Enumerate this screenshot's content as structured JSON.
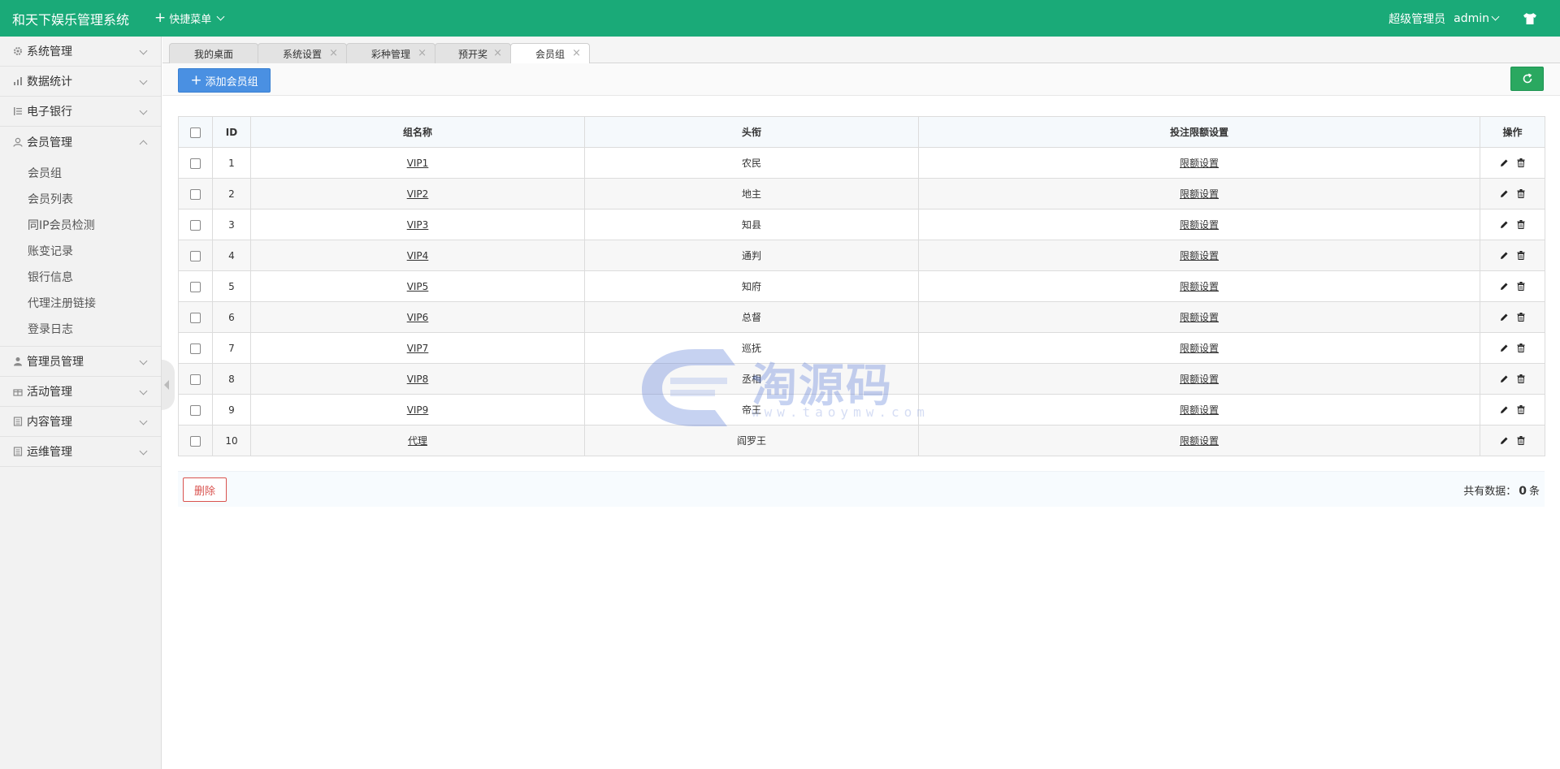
{
  "header": {
    "brand": "和天下娱乐管理系统",
    "quick_menu": "快捷菜单",
    "role": "超级管理员",
    "user": "admin"
  },
  "sidebar": {
    "items": [
      {
        "label": "系统管理",
        "icon": "gear-icon"
      },
      {
        "label": "数据统计",
        "icon": "chart-icon"
      },
      {
        "label": "电子银行",
        "icon": "list-icon"
      },
      {
        "label": "会员管理",
        "icon": "user-icon"
      },
      {
        "label": "管理员管理",
        "icon": "admin-icon"
      },
      {
        "label": "活动管理",
        "icon": "gift-icon"
      },
      {
        "label": "内容管理",
        "icon": "doc-icon"
      },
      {
        "label": "运维管理",
        "icon": "server-icon"
      }
    ],
    "member_sub": [
      "会员组",
      "会员列表",
      "同IP会员检测",
      "账变记录",
      "银行信息",
      "代理注册链接",
      "登录日志"
    ]
  },
  "tabs": [
    {
      "label": "我的桌面"
    },
    {
      "label": "系统设置"
    },
    {
      "label": "彩种管理"
    },
    {
      "label": "预开奖"
    },
    {
      "label": "会员组"
    }
  ],
  "toolbar": {
    "add_label": "添加会员组"
  },
  "table": {
    "headers": [
      "ID",
      "组名称",
      "头衔",
      "投注限额设置",
      "操作"
    ],
    "rows": [
      {
        "id": "1",
        "name": "VIP1",
        "title": "农民",
        "limit": "限额设置"
      },
      {
        "id": "2",
        "name": "VIP2",
        "title": "地主",
        "limit": "限额设置"
      },
      {
        "id": "3",
        "name": "VIP3",
        "title": "知县",
        "limit": "限额设置"
      },
      {
        "id": "4",
        "name": "VIP4",
        "title": "通判",
        "limit": "限额设置"
      },
      {
        "id": "5",
        "name": "VIP5",
        "title": "知府",
        "limit": "限额设置"
      },
      {
        "id": "6",
        "name": "VIP6",
        "title": "总督",
        "limit": "限额设置"
      },
      {
        "id": "7",
        "name": "VIP7",
        "title": "巡抚",
        "limit": "限额设置"
      },
      {
        "id": "8",
        "name": "VIP8",
        "title": "丞相",
        "limit": "限额设置"
      },
      {
        "id": "9",
        "name": "VIP9",
        "title": "帝王",
        "limit": "限额设置"
      },
      {
        "id": "10",
        "name": "代理",
        "title": "阎罗王",
        "limit": "限额设置"
      }
    ]
  },
  "footer": {
    "delete_label": "删除",
    "total_prefix": "共有数据：",
    "total_count": "0",
    "total_suffix": "条"
  },
  "watermark": {
    "text": "淘源码",
    "url": "www.taoymw.com"
  },
  "colors": {
    "header": "#1aaa78",
    "primary": "#4a90e2",
    "refresh": "#2aa860",
    "danger": "#d9534f"
  }
}
